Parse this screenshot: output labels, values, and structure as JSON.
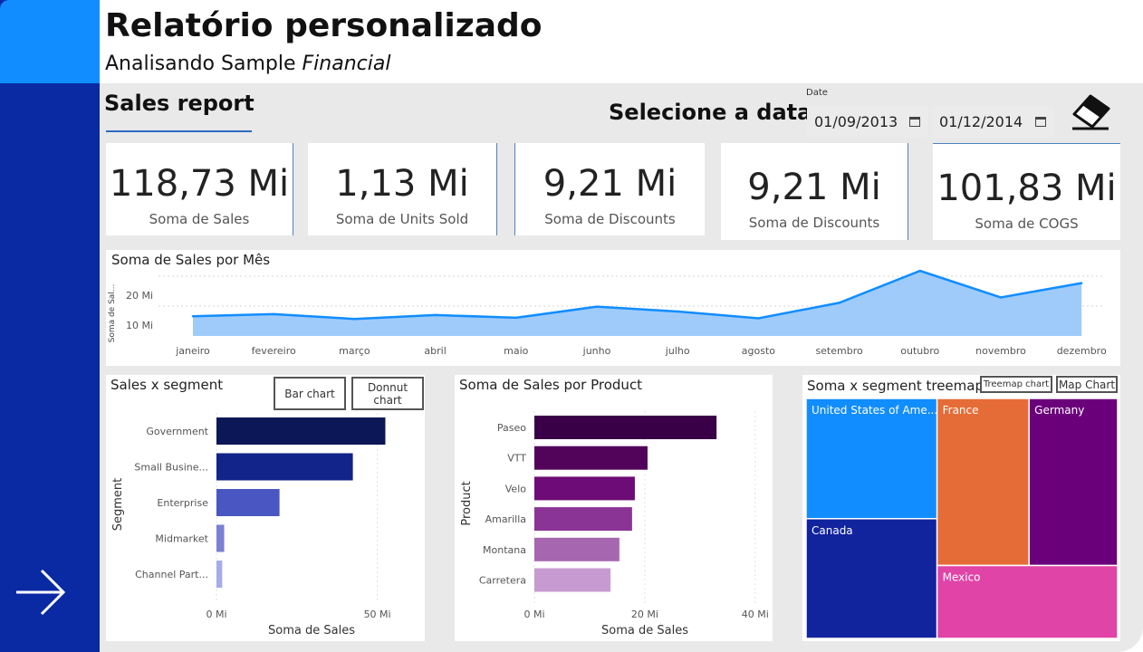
{
  "header": {
    "title": "Relatório personalizado",
    "subtitle_prefix": "Analisando Sample ",
    "subtitle_italic": "Financial"
  },
  "tab": {
    "label": "Sales report"
  },
  "date_filter": {
    "label": "Selecione a data",
    "caption": "Date",
    "start": "01/09/2013",
    "end": "01/12/2014",
    "clear_icon": "eraser-icon",
    "calendar_icon": "calendar-icon"
  },
  "nav": {
    "next_icon": "arrow-right-icon"
  },
  "kpis": [
    {
      "value": "118,73 Mi",
      "label": "Soma de  Sales"
    },
    {
      "value": "1,13 Mi",
      "label": "Soma de Units Sold"
    },
    {
      "value": "9,21 Mi",
      "label": "Soma de Discounts"
    },
    {
      "value": "9,21 Mi",
      "label": "Soma de Discounts"
    },
    {
      "value": "101,83 Mi",
      "label": "Soma de COGS"
    }
  ],
  "line_chart": {
    "title": "Soma de Sales por Mês",
    "ylabel": "Soma de Sal...",
    "yticks": [
      "20 Mi",
      "10 Mi"
    ]
  },
  "segment_chart": {
    "title": "Sales x segment",
    "buttons": {
      "bar": "Bar chart",
      "donut": "Donnut chart"
    }
  },
  "product_chart": {
    "title": "Soma de Sales por Product"
  },
  "treemap_chart": {
    "title": "Soma x segment treemap",
    "buttons": {
      "treemap": "Treemap chart",
      "map": "Map Chart"
    }
  },
  "chart_data": [
    {
      "type": "area",
      "title": "Soma de Sales por Mês",
      "ylabel": "Soma de Sal...",
      "categories": [
        "janeiro",
        "fevereiro",
        "março",
        "abril",
        "maio",
        "junho",
        "julho",
        "agosto",
        "setembro",
        "outubro",
        "novembro",
        "dezembro"
      ],
      "values": [
        6.6,
        7.3,
        5.7,
        7.0,
        6.1,
        9.8,
        8.2,
        5.9,
        11.1,
        21.8,
        12.9,
        17.7
      ],
      "yticks": [
        10,
        20
      ],
      "ytick_labels": [
        "10 Mi",
        "20 Mi"
      ],
      "ylim": [
        0,
        25
      ],
      "color": "#118dff"
    },
    {
      "type": "bar",
      "orientation": "horizontal",
      "title": "Sales x segment",
      "xlabel": "Soma de Sales",
      "ylabel": "Segment",
      "categories": [
        "Government",
        "Small Busine...",
        "Enterprise",
        "Midmarket",
        "Channel Part..."
      ],
      "values": [
        52.5,
        42.4,
        19.6,
        2.4,
        1.8
      ],
      "xticks": [
        0,
        50
      ],
      "xtick_labels": [
        "0 Mi",
        "50 Mi"
      ],
      "xlim": [
        0,
        58
      ],
      "colors": [
        "#0c1757",
        "#12238a",
        "#4a56c1",
        "#7a80d3",
        "#a6acea"
      ]
    },
    {
      "type": "bar",
      "orientation": "horizontal",
      "title": "Soma de Sales por Product",
      "xlabel": "Soma de Sales",
      "ylabel": "Product",
      "categories": [
        "Paseo",
        "VTT",
        "Velo",
        "Amarilla",
        "Montana",
        "Carretera"
      ],
      "values": [
        33.0,
        20.5,
        18.2,
        17.7,
        15.4,
        13.8
      ],
      "xticks": [
        0,
        20,
        40
      ],
      "xtick_labels": [
        "0 Mi",
        "20 Mi",
        "40 Mi"
      ],
      "xlim": [
        0,
        42
      ],
      "colors": [
        "#3a0047",
        "#52045a",
        "#6d0c76",
        "#8a3596",
        "#a666b0",
        "#c79bd1"
      ]
    },
    {
      "type": "treemap",
      "title": "Soma x segment treemap",
      "items": [
        {
          "name": "United States of Ame...",
          "value": 25,
          "color": "#118dff"
        },
        {
          "name": "Canada",
          "value": 24.9,
          "color": "#12239e"
        },
        {
          "name": "France",
          "value": 24.4,
          "color": "#e66c37"
        },
        {
          "name": "Germany",
          "value": 23.5,
          "color": "#6b007b"
        },
        {
          "name": "Mexico",
          "value": 20.9,
          "color": "#e044a7"
        }
      ]
    }
  ]
}
